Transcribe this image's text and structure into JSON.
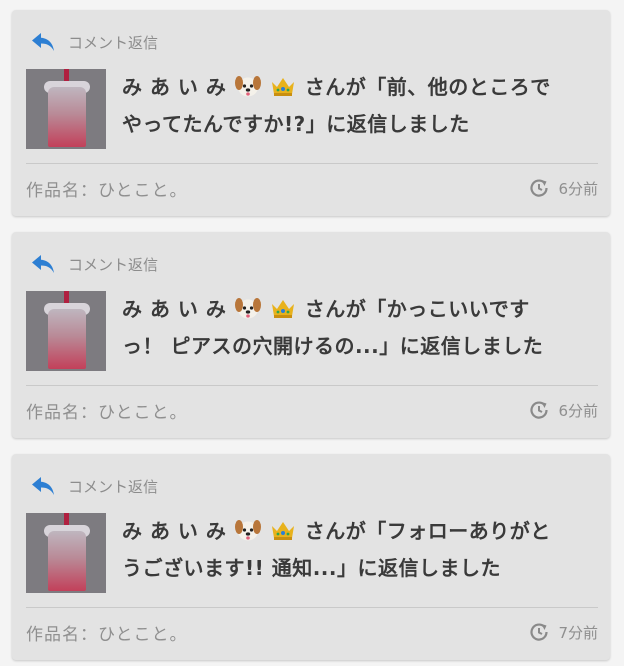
{
  "notifications": [
    {
      "header_label": "コメント返信",
      "user_name": "み あ い み",
      "emojis": [
        "dog-face",
        "crown"
      ],
      "message_line1_suffix": "さんが「前、他のところで",
      "message_line2": "やってたんですか!?」に返信しました",
      "work_name": "作品名：ひとこと。",
      "time_ago": "6分前"
    },
    {
      "header_label": "コメント返信",
      "user_name": "み あ い み",
      "emojis": [
        "dog-face",
        "crown"
      ],
      "message_line1_suffix": "さんが「かっこいいです",
      "message_line2": "っ！ ピアスの穴開けるの...」に返信しました",
      "work_name": "作品名：ひとこと。",
      "time_ago": "6分前"
    },
    {
      "header_label": "コメント返信",
      "user_name": "み あ い み",
      "emojis": [
        "dog-face",
        "crown"
      ],
      "message_line1_suffix": "さんが「フォローありがと",
      "message_line2": "うございます!! 通知...」に返信しました",
      "work_name": "作品名：ひとこと。",
      "time_ago": "7分前"
    }
  ],
  "colors": {
    "accent": "#2d7fd3",
    "card_bg": "#e3e3e3",
    "text_dark": "#3a3a3a",
    "text_muted": "#8f8f8f"
  }
}
